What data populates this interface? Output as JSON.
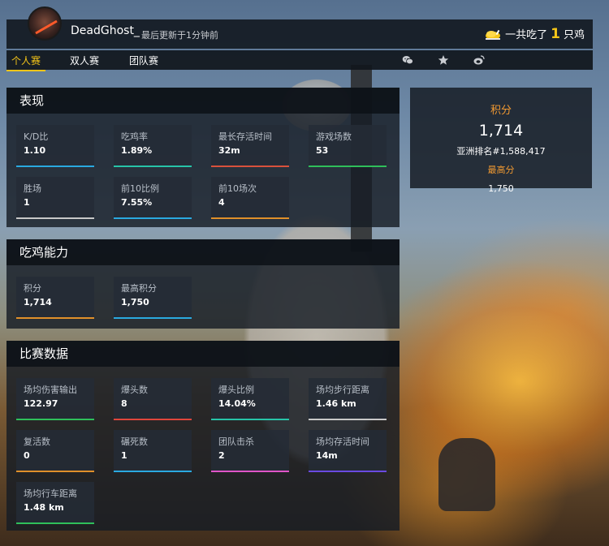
{
  "profile": {
    "username": "DeadGhost_",
    "updated": "最后更新于1分钟前"
  },
  "chicken": {
    "prefix": "一共吃了",
    "count": "1",
    "suffix": "只鸡"
  },
  "tabs": [
    {
      "label": "个人赛",
      "active": true
    },
    {
      "label": "双人赛",
      "active": false
    },
    {
      "label": "团队赛",
      "active": false
    }
  ],
  "share_icons": [
    "wechat-icon",
    "star-icon",
    "weibo-icon"
  ],
  "performance": {
    "title": "表现",
    "stats": [
      {
        "label": "K/D比",
        "value": "1.10",
        "color": "#2aa9e0"
      },
      {
        "label": "吃鸡率",
        "value": "1.89%",
        "color": "#27c4a8"
      },
      {
        "label": "最长存活时间",
        "value": "32m",
        "color": "#d9513c"
      },
      {
        "label": "游戏场数",
        "value": "53",
        "color": "#2fbf5a"
      },
      {
        "label": "胜场",
        "value": "1",
        "color": "#c8c8c8"
      },
      {
        "label": "前10比例",
        "value": "7.55%",
        "color": "#2aa9e0"
      },
      {
        "label": "前10场次",
        "value": "4",
        "color": "#e0902a"
      }
    ]
  },
  "chicken_ability": {
    "title": "吃鸡能力",
    "stats": [
      {
        "label": "积分",
        "value": "1,714",
        "color": "#e0902a"
      },
      {
        "label": "最高积分",
        "value": "1,750",
        "color": "#2aa9e0"
      }
    ]
  },
  "match_data": {
    "title": "比赛数据",
    "stats": [
      {
        "label": "场均伤害输出",
        "value": "122.97",
        "color": "#2fbf5a"
      },
      {
        "label": "爆头数",
        "value": "8",
        "color": "#e0463c"
      },
      {
        "label": "爆头比例",
        "value": "14.04%",
        "color": "#27c4a8"
      },
      {
        "label": "场均步行距离",
        "value": "1.46 km",
        "color": "#c8c8c8"
      },
      {
        "label": "复活数",
        "value": "0",
        "color": "#e0902a"
      },
      {
        "label": "碾死数",
        "value": "1",
        "color": "#2aa9e0"
      },
      {
        "label": "团队击杀",
        "value": "2",
        "color": "#e055c8"
      },
      {
        "label": "场均存活时间",
        "value": "14m",
        "color": "#6a4ae0"
      },
      {
        "label": "场均行车距离",
        "value": "1.48 km",
        "color": "#2fbf5a"
      }
    ]
  },
  "score": {
    "title": "积分",
    "value": "1,714",
    "rank": "亚洲排名#1,588,417",
    "peak_label": "最高分",
    "peak_value": "1,750"
  }
}
